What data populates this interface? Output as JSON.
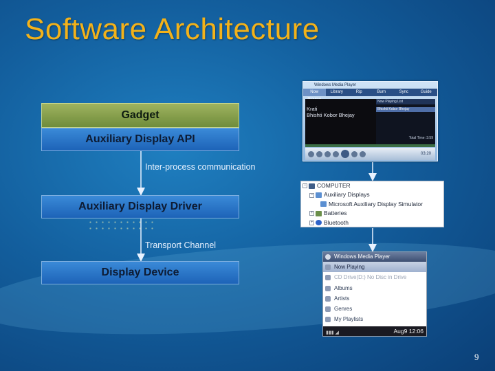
{
  "slide": {
    "title": "Software Architecture",
    "page_number": "9"
  },
  "layers": {
    "gadget": "Gadget",
    "api": "Auxiliary Display API",
    "driver": "Auxiliary Display Driver",
    "device": "Display Device"
  },
  "connections": {
    "ipc": "Inter-process communication",
    "transport": "Transport Channel"
  },
  "media_player": {
    "window_title": "Windows Media Player",
    "tabs": [
      "Now Playing",
      "Library",
      "Rip",
      "Burn",
      "Sync",
      "Guide"
    ],
    "track_line_1": "Krati",
    "track_line_2": "Bhishti Kobor Bhejay",
    "list_header": "Now Playing List",
    "list_item": "Bhishti Kobor Bhejay",
    "total_time": "Total Time: 3:59",
    "elapsed": "03:20"
  },
  "device_tree": {
    "root": "COMPUTER",
    "items": [
      "Auxiliary Displays",
      "Microsoft Auxiliary Display Simulator",
      "Batteries",
      "Bluetooth"
    ]
  },
  "mobile": {
    "app_title": "Windows Media Player",
    "menu": [
      "Now Playing",
      "CD Drive(D:) No Disc in Drive",
      "Albums",
      "Artists",
      "Genres",
      "My Playlists"
    ],
    "status_time": "Aug9 12:06"
  }
}
